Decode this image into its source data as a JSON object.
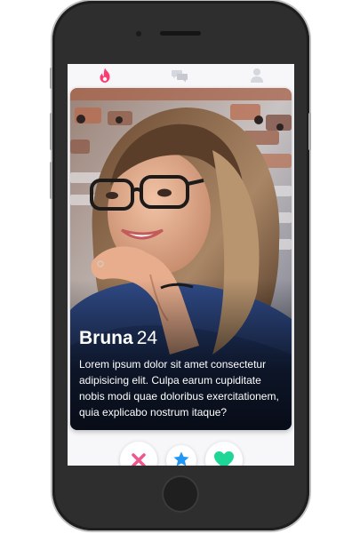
{
  "profile": {
    "name": "Bruna",
    "age": "24",
    "bio": "Lorem ipsum dolor sit amet consectetur adipisicing elit. Culpa earum cupiditate nobis modi quae doloribus exercitationem, quia explicabo nostrum itaque?"
  },
  "nav": {
    "items": [
      {
        "icon": "flame-icon",
        "active": true
      },
      {
        "icon": "chat-icon",
        "active": false
      },
      {
        "icon": "user-icon",
        "active": false
      }
    ]
  },
  "actions": [
    {
      "icon": "close-icon",
      "label": "dislike"
    },
    {
      "icon": "star-icon",
      "label": "super-like"
    },
    {
      "icon": "heart-icon",
      "label": "like"
    }
  ],
  "colors": {
    "brand": "#fe3c72",
    "inactive": "#d4d7dd",
    "dislike": "#f0558c",
    "star": "#2196f3",
    "like": "#1ed696"
  }
}
